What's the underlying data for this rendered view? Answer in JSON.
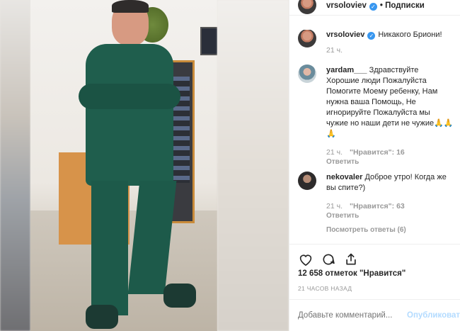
{
  "post": {
    "author": "vrsoloviev",
    "follow_label": "• Подписки",
    "caption_author": "vrsoloviev",
    "caption_text": "Никакого Бриони!",
    "caption_time": "21 ч."
  },
  "comments": [
    {
      "author": "yardam___",
      "text": "Здравствуйте Хорошие люди Пожалуйста Помогите Моему ребенку, Нам нужна ваша Помощь, Не игнорируйте Пожалуйста мы чужие но наши дети не чужие🙏🙏🙏",
      "time": "21 ч.",
      "likes": "\"Нравится\": 16",
      "reply": "Ответить"
    },
    {
      "author": "nekovaler",
      "text": "Доброе утро! Когда же вы спите?)",
      "time": "21 ч.",
      "likes": "\"Нравится\": 63",
      "reply": "Ответить",
      "more_replies": "Посмотреть ответы (6)"
    }
  ],
  "actions": {
    "like_icon": "heart-icon",
    "comment_icon": "comment-icon",
    "share_icon": "share-icon"
  },
  "likes_count": "12 658 отметок \"Нравится\"",
  "posted_ago": "21 ЧАСОВ НАЗАД",
  "comment_box": {
    "placeholder": "Добавьте комментарий...",
    "publish_label": "Опубликовать"
  },
  "colors": {
    "verified": "#3897f0",
    "publish_disabled": "#b3dbff",
    "muted": "#999999"
  }
}
